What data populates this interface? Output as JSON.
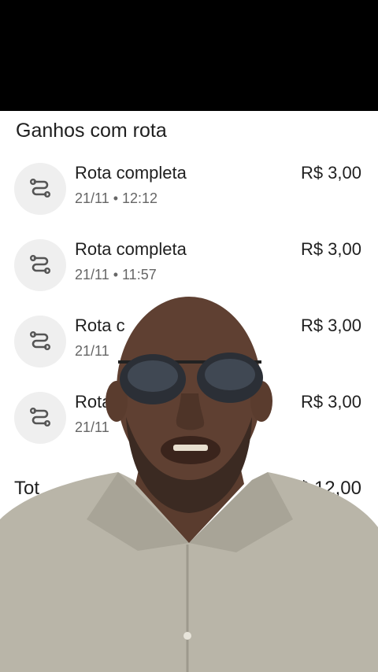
{
  "header": {
    "title": "Ganhos com rota"
  },
  "rows": [
    {
      "title": "Rota completa",
      "date": "21/11 • 12:12",
      "amount": "R$ 3,00"
    },
    {
      "title": "Rota completa",
      "date": "21/11 • 11:57",
      "amount": "R$ 3,00"
    },
    {
      "title": "Rota c",
      "date": "21/11",
      "amount": "R$ 3,00"
    },
    {
      "title": "Rota",
      "date": "21/11",
      "amount": "R$ 3,00"
    }
  ],
  "total": {
    "label": "Tot",
    "amount": "R$ 12,00"
  },
  "icons": {
    "route": "route-icon"
  },
  "colors": {
    "text": "#1f1f1f",
    "secondary": "#666666",
    "icon_bg": "#efefef"
  }
}
